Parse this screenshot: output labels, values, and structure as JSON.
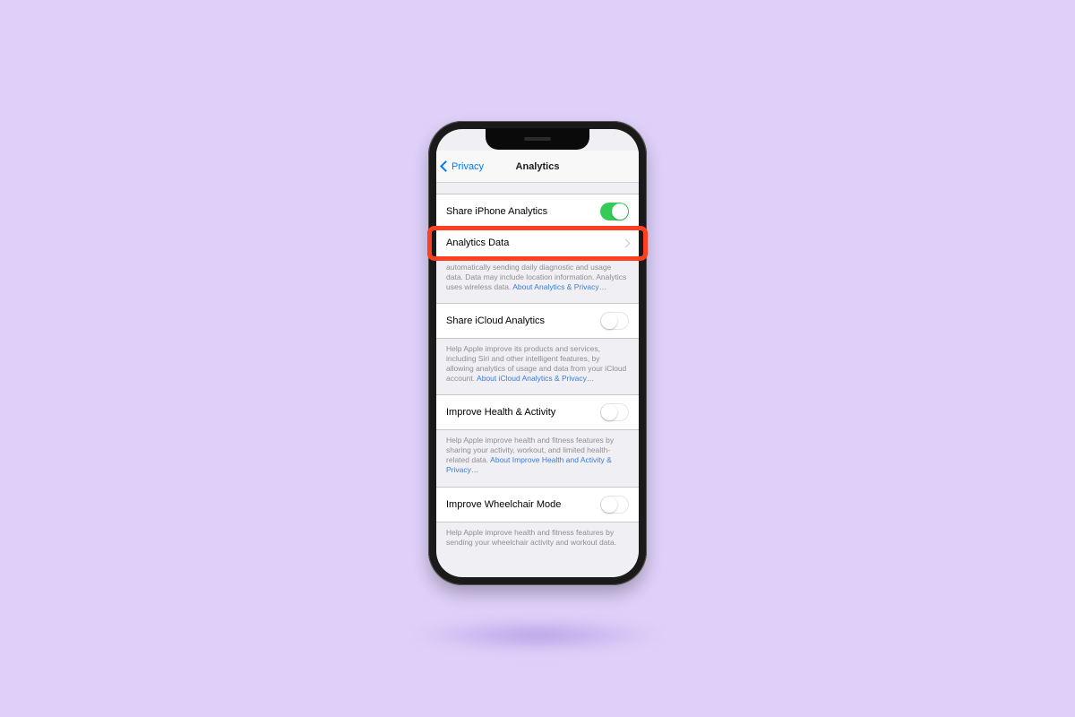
{
  "colors": {
    "background": "#ded0f9",
    "highlight": "#ff3f20",
    "ios_blue": "#007aff",
    "toggle_on": "#35cc56"
  },
  "nav": {
    "back_label": "Privacy",
    "title": "Analytics"
  },
  "sections": [
    {
      "rows": [
        {
          "id": "share-iphone-analytics",
          "label": "Share iPhone Analytics",
          "type": "toggle",
          "value": true
        },
        {
          "id": "analytics-data",
          "label": "Analytics Data",
          "type": "disclosure",
          "highlighted": true
        }
      ],
      "footer": {
        "text_partial": "automatically sending daily diagnostic and usage data. Data may include location information. Analytics uses wireless data.",
        "link": "About Analytics & Privacy…"
      }
    },
    {
      "rows": [
        {
          "id": "share-icloud-analytics",
          "label": "Share iCloud Analytics",
          "type": "toggle",
          "value": false
        }
      ],
      "footer": {
        "text": "Help Apple improve its products and services, including Siri and other intelligent features, by allowing analytics of usage and data from your iCloud account.",
        "link": "About iCloud Analytics & Privacy…"
      }
    },
    {
      "rows": [
        {
          "id": "improve-health-activity",
          "label": "Improve Health & Activity",
          "type": "toggle",
          "value": false
        }
      ],
      "footer": {
        "text": "Help Apple improve health and fitness features by sharing your activity, workout, and limited health-related data.",
        "link": "About Improve Health and Activity & Privacy…"
      }
    },
    {
      "rows": [
        {
          "id": "improve-wheelchair-mode",
          "label": "Improve Wheelchair Mode",
          "type": "toggle",
          "value": false
        }
      ],
      "footer": {
        "text": "Help Apple improve health and fitness features by sending your wheelchair activity and workout data.",
        "link": ""
      }
    }
  ]
}
